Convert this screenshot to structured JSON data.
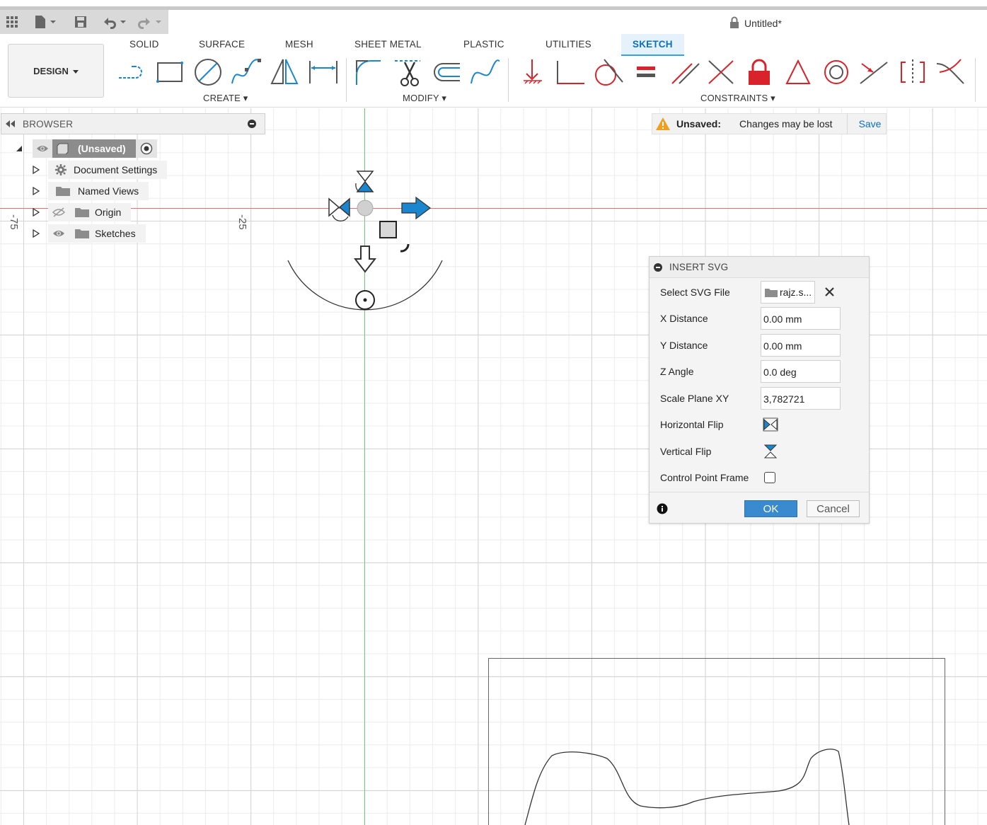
{
  "document": {
    "title": "Untitled*"
  },
  "workspace": {
    "label": "DESIGN"
  },
  "tabs": [
    {
      "label": "SOLID",
      "active": false
    },
    {
      "label": "SURFACE",
      "active": false
    },
    {
      "label": "MESH",
      "active": false
    },
    {
      "label": "SHEET METAL",
      "active": false
    },
    {
      "label": "PLASTIC",
      "active": false
    },
    {
      "label": "UTILITIES",
      "active": false
    },
    {
      "label": "SKETCH",
      "active": true
    }
  ],
  "groups": {
    "create": "CREATE",
    "modify": "MODIFY",
    "constraints": "CONSTRAINTS"
  },
  "browser": {
    "title": "BROWSER",
    "items": [
      {
        "label": "(Unsaved)"
      },
      {
        "label": "Document Settings"
      },
      {
        "label": "Named Views"
      },
      {
        "label": "Origin"
      },
      {
        "label": "Sketches"
      }
    ]
  },
  "notice": {
    "label": "Unsaved:",
    "message": "Changes may be lost",
    "action": "Save"
  },
  "axis": {
    "left_label": "-75",
    "mid_label": "-25"
  },
  "dialog": {
    "title": "INSERT SVG",
    "select_file_label": "Select SVG File",
    "file_name": "rajz.s...",
    "x_label": "X Distance",
    "x_value": "0.00 mm",
    "y_label": "Y Distance",
    "y_value": "0.00 mm",
    "z_label": "Z Angle",
    "z_value": "0.0 deg",
    "scale_label": "Scale Plane XY",
    "scale_value": "3,782721",
    "hflip_label": "Horizontal Flip",
    "vflip_label": "Vertical Flip",
    "cpf_label": "Control Point Frame",
    "ok": "OK",
    "cancel": "Cancel"
  },
  "colors": {
    "accent": "#0a70c0",
    "constraint_red": "#d8232a",
    "tool_blue": "#1a86d0",
    "annotation_red": "#e0101a"
  }
}
